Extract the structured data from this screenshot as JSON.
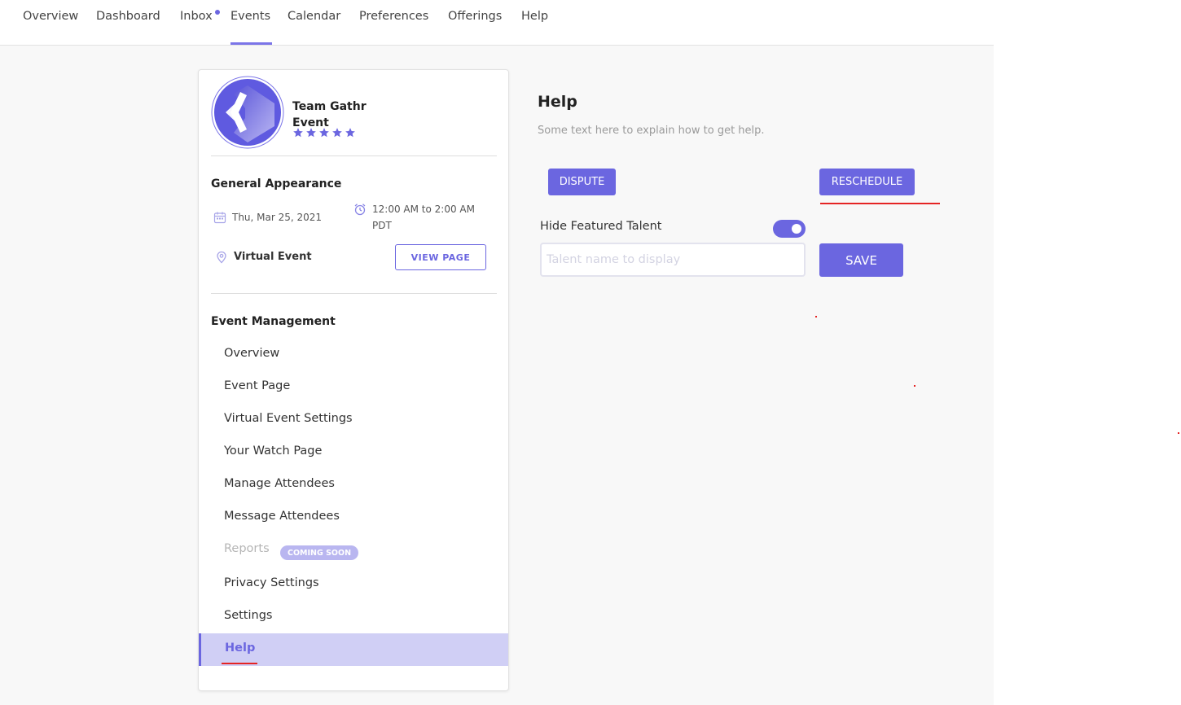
{
  "nav": {
    "items": [
      {
        "label": "Overview"
      },
      {
        "label": "Dashboard"
      },
      {
        "label": "Inbox"
      },
      {
        "label": "Events"
      },
      {
        "label": "Calendar"
      },
      {
        "label": "Preferences"
      },
      {
        "label": "Offerings"
      },
      {
        "label": "Help"
      }
    ],
    "active": "Events"
  },
  "event": {
    "name": "Team Gathr Event",
    "rating": 5
  },
  "appearance": {
    "title": "General Appearance",
    "date": "Thu, Mar 25, 2021",
    "time": "12:00 AM to 2:00 AM PDT",
    "location": "Virtual Event",
    "view_page_label": "VIEW PAGE"
  },
  "management": {
    "title": "Event Management",
    "items": [
      {
        "label": "Overview"
      },
      {
        "label": "Event Page"
      },
      {
        "label": "Virtual Event Settings"
      },
      {
        "label": "Your Watch Page"
      },
      {
        "label": "Manage Attendees"
      },
      {
        "label": "Message Attendees"
      },
      {
        "label": "Reports"
      },
      {
        "label": "Privacy Settings"
      },
      {
        "label": "Settings"
      },
      {
        "label": "Help"
      }
    ],
    "coming_soon": "COMING SOON",
    "active": "Help"
  },
  "help": {
    "title": "Help",
    "description": "Some text here to explain how to get help.",
    "dispute_label": "DISPUTE",
    "reschedule_label": "RESCHEDULE",
    "toggle_label": "Hide Featured Talent",
    "toggle_on": true,
    "talent_placeholder": "Talent name to display",
    "save_label": "SAVE"
  },
  "colors": {
    "accent": "#6b66e0",
    "active_bg": "#d0cff5",
    "annotation_red": "#e52424"
  }
}
